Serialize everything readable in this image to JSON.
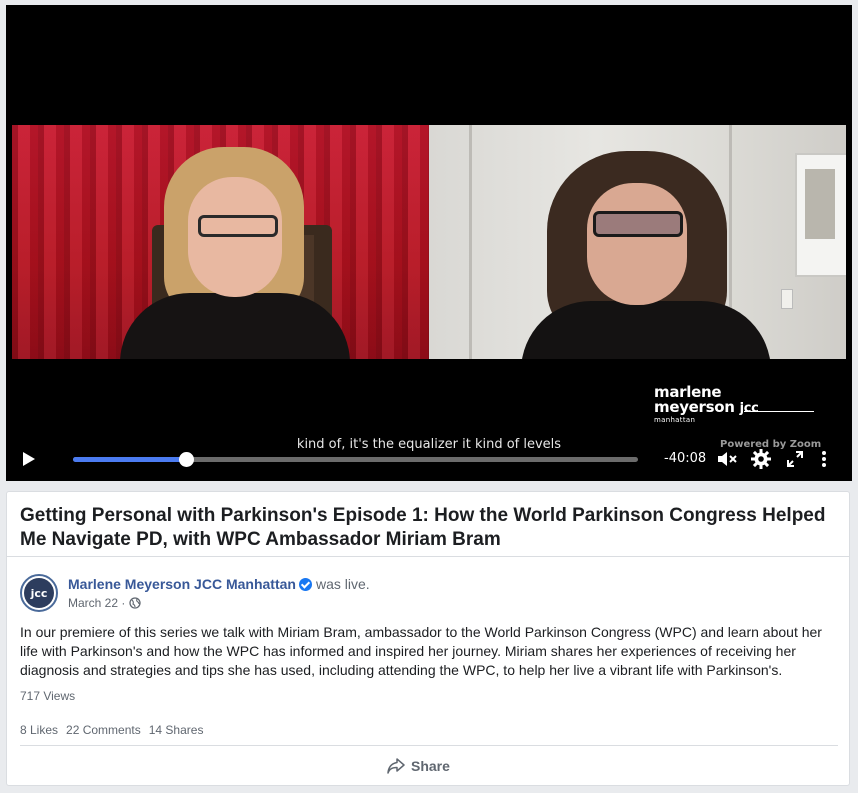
{
  "player": {
    "caption": "kind of, it's the equalizer it kind of levels",
    "brand_line1": "marlene",
    "brand_line2": "meyerson",
    "brand_jcc": "jcc",
    "brand_line3": "manhattan",
    "powered_by": "Powered by Zoom",
    "time_remaining": "-40:08",
    "progress_fraction": 0.2,
    "progress_color": "#4b7bf0",
    "icons": {
      "play": "play-icon",
      "mute": "volume-muted-icon",
      "settings": "gear-icon",
      "fullscreen": "fullscreen-icon",
      "more": "more-vertical-icon"
    }
  },
  "post": {
    "title": "Getting Personal with Parkinson's Episode 1: How the World Parkinson Congress Helped Me Navigate PD, with WPC Ambassador Miriam Bram",
    "avatar_text": "jcc",
    "author": "Marlene Meyerson JCC Manhattan",
    "author_suffix": "was live.",
    "date": "March 22 ·",
    "description": "In our premiere of this series we talk with Miriam Bram, ambassador to the World Parkinson Congress (WPC) and learn about her life with Parkinson's and how the WPC has informed and inspired her journey. Miriam shares her experiences of receiving her diagnosis and strategies and tips she has used, including attending the WPC, to help her live a vibrant life with Parkinson's.",
    "views": "717 Views",
    "likes": "8 Likes",
    "comments": "22 Comments",
    "shares": "14 Shares",
    "share_label": "Share",
    "link_color": "#385898",
    "verified_color": "#1877f2"
  }
}
